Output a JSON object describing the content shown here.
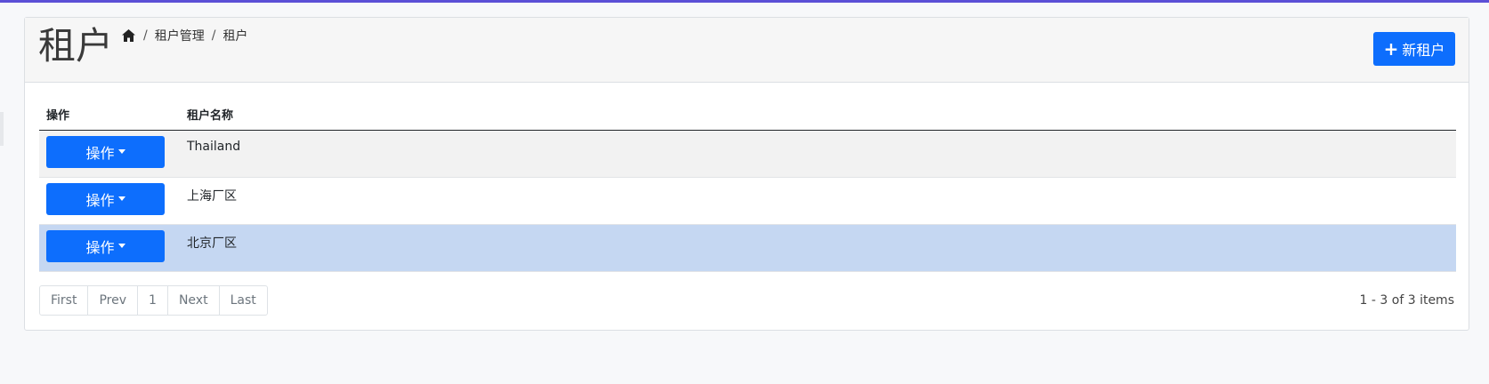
{
  "colors": {
    "accent_strip": "#5b4fd6",
    "primary": "#0d6efd",
    "selected_row": "#c5d7f2",
    "striped_row": "#f2f2f2"
  },
  "header": {
    "title": "租户",
    "breadcrumb": {
      "home_icon": "home-icon",
      "items": [
        "租户管理",
        "租户"
      ],
      "separator": "/"
    },
    "new_button": {
      "icon": "plus-icon",
      "label": "新租户"
    }
  },
  "table": {
    "columns": [
      "操作",
      "租户名称"
    ],
    "rows": [
      {
        "action_label": "操作",
        "name": "Thailand",
        "state": "striped"
      },
      {
        "action_label": "操作",
        "name": "上海厂区",
        "state": "normal"
      },
      {
        "action_label": "操作",
        "name": "北京厂区",
        "state": "selected"
      }
    ]
  },
  "pagination": {
    "first": "First",
    "prev": "Prev",
    "page": "1",
    "next": "Next",
    "last": "Last",
    "info": "1 - 3 of 3 items"
  }
}
